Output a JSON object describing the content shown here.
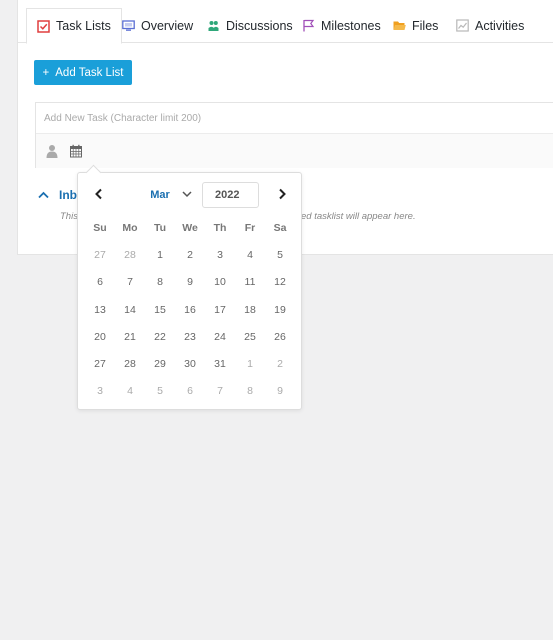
{
  "tabs": [
    {
      "label": "Task Lists",
      "icon": "checkbox-icon",
      "color": "#e03e3e",
      "active": true
    },
    {
      "label": "Overview",
      "icon": "monitor-icon",
      "color": "#5b6fd4"
    },
    {
      "label": "Discussions",
      "icon": "users-icon",
      "color": "#2fa77a"
    },
    {
      "label": "Milestones",
      "icon": "flag-icon",
      "color": "#a04fb8"
    },
    {
      "label": "Files",
      "icon": "folder-icon",
      "color": "#f0a020"
    },
    {
      "label": "Activities",
      "icon": "chart-icon",
      "color": "#b8b8b8"
    }
  ],
  "add_task_list": {
    "label": "Add Task List",
    "icon": "plus-icon",
    "color": "#1a9fd9"
  },
  "new_task": {
    "placeholder": "Add New Task (Character limit 200)",
    "tools": [
      "user-icon",
      "calendar-icon"
    ]
  },
  "inbox": {
    "title": "Inb",
    "note_left": "This",
    "note_right": "ed tasklist will appear here."
  },
  "datepicker": {
    "month": "Mar",
    "year": "2022",
    "weekdays": [
      "Su",
      "Mo",
      "Tu",
      "We",
      "Th",
      "Fr",
      "Sa"
    ],
    "weeks": [
      [
        "27",
        "28",
        "1",
        "2",
        "3",
        "4",
        "5"
      ],
      [
        "6",
        "7",
        "8",
        "9",
        "10",
        "11",
        "12"
      ],
      [
        "13",
        "14",
        "15",
        "16",
        "17",
        "18",
        "19"
      ],
      [
        "20",
        "21",
        "22",
        "23",
        "24",
        "25",
        "26"
      ],
      [
        "27",
        "28",
        "29",
        "30",
        "31",
        "1",
        "2"
      ],
      [
        "3",
        "4",
        "5",
        "6",
        "7",
        "8",
        "9"
      ]
    ],
    "other_month_mask": [
      [
        1,
        1,
        0,
        0,
        0,
        0,
        0
      ],
      [
        0,
        0,
        0,
        0,
        0,
        0,
        0
      ],
      [
        0,
        0,
        0,
        0,
        0,
        0,
        0
      ],
      [
        0,
        0,
        0,
        0,
        0,
        0,
        0
      ],
      [
        0,
        0,
        0,
        0,
        0,
        1,
        1
      ],
      [
        1,
        1,
        1,
        1,
        1,
        1,
        1
      ]
    ]
  }
}
